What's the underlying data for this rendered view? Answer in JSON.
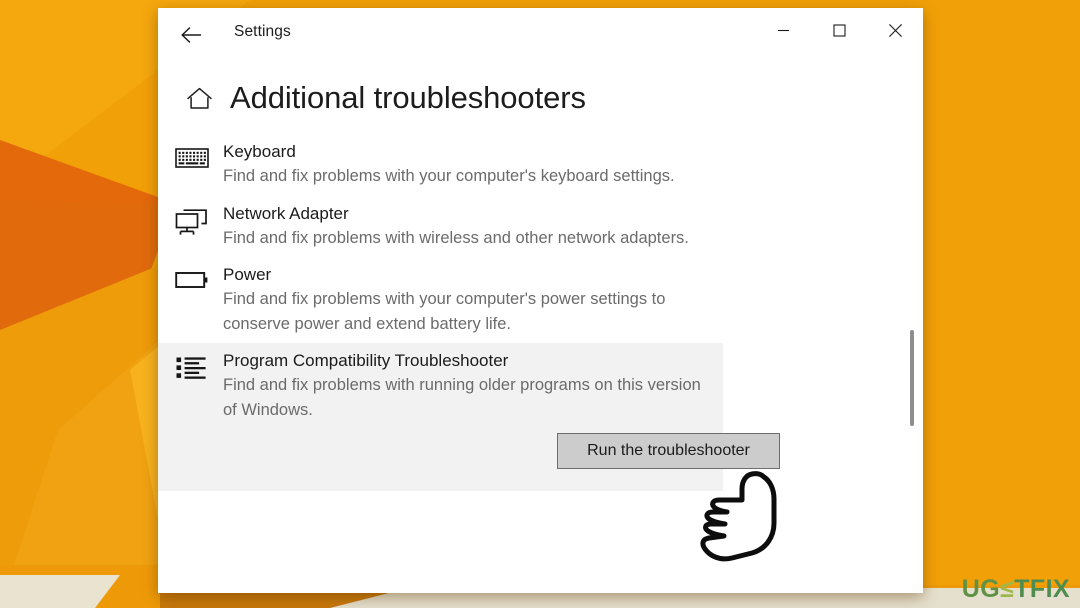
{
  "window": {
    "title": "Settings",
    "back_icon": "back-arrow-icon",
    "minimize_label": "─",
    "maximize_label": "□",
    "close_label": "✕"
  },
  "page": {
    "home_icon": "home-icon",
    "heading": "Additional troubleshooters"
  },
  "troubleshooters": [
    {
      "icon": "keyboard-icon",
      "name": "Keyboard",
      "description": "Find and fix problems with your computer's keyboard settings.",
      "selected": false
    },
    {
      "icon": "network-adapter-icon",
      "name": "Network Adapter",
      "description": "Find and fix problems with wireless and other network adapters.",
      "selected": false
    },
    {
      "icon": "battery-icon",
      "name": "Power",
      "description": "Find and fix problems with your computer's power settings to conserve power and extend battery life.",
      "selected": false
    },
    {
      "icon": "list-icon",
      "name": "Program Compatibility Troubleshooter",
      "description": "Find and fix problems with running older programs on this version of Windows.",
      "selected": true
    }
  ],
  "actions": {
    "run_button_label": "Run the troubleshooter"
  },
  "cursor": {
    "type": "pointing-hand-cursor"
  },
  "watermark": {
    "prefix": "UG",
    "middle": "≤",
    "suffix": "TFIX"
  },
  "colors": {
    "background_amber": "#F2A007",
    "background_orange": "#E4690B",
    "background_light_amber": "#F5AB1B",
    "window_white": "#FFFFFF",
    "selected_row": "#F2F2F2",
    "button_face": "#CCCCCC",
    "button_border": "#6D6D6D",
    "text_primary": "#1B1B1B",
    "text_secondary": "#6B6B6B",
    "scrollbar_thumb": "#8E8E8E",
    "watermark_green": "#5F9245"
  }
}
